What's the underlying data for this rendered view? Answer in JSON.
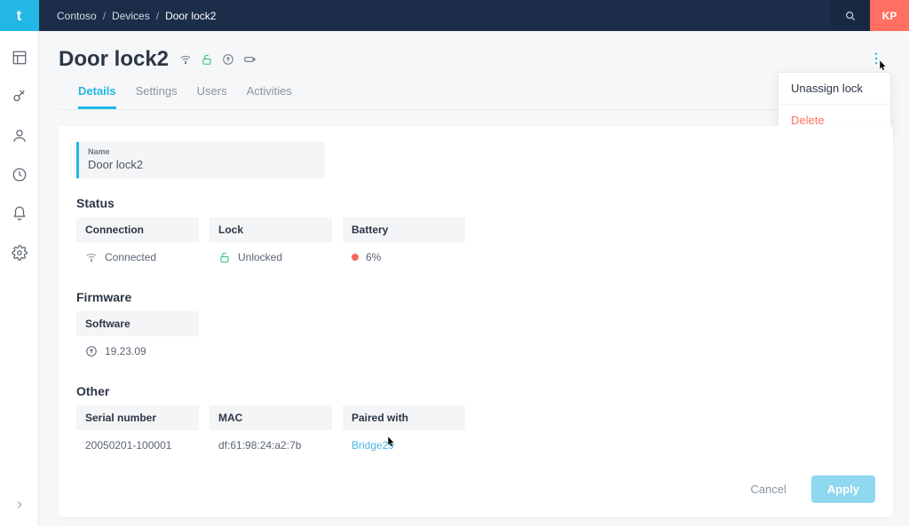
{
  "logo_letter": "t",
  "breadcrumbs": {
    "org": "Contoso",
    "section": "Devices",
    "item": "Door lock2"
  },
  "search_placeholder": "Search",
  "user_initials": "KP",
  "title": "Door lock2",
  "more_menu": {
    "unassign": "Unassign lock",
    "delete": "Delete"
  },
  "tabs": {
    "details": "Details",
    "settings": "Settings",
    "users": "Users",
    "activities": "Activities"
  },
  "name_field": {
    "label": "Name",
    "value": "Door lock2"
  },
  "status": {
    "heading": "Status",
    "connection": {
      "label": "Connection",
      "value": "Connected"
    },
    "lock": {
      "label": "Lock",
      "value": "Unlocked"
    },
    "battery": {
      "label": "Battery",
      "value": "6%"
    }
  },
  "firmware": {
    "heading": "Firmware",
    "software": {
      "label": "Software",
      "value": "19.23.09"
    }
  },
  "other": {
    "heading": "Other",
    "serial": {
      "label": "Serial number",
      "value": "20050201-100001"
    },
    "mac": {
      "label": "MAC",
      "value": "df:61:98:24:a2:7b"
    },
    "paired": {
      "label": "Paired with",
      "value": "Bridge29"
    }
  },
  "actions": {
    "cancel": "Cancel",
    "apply": "Apply"
  }
}
